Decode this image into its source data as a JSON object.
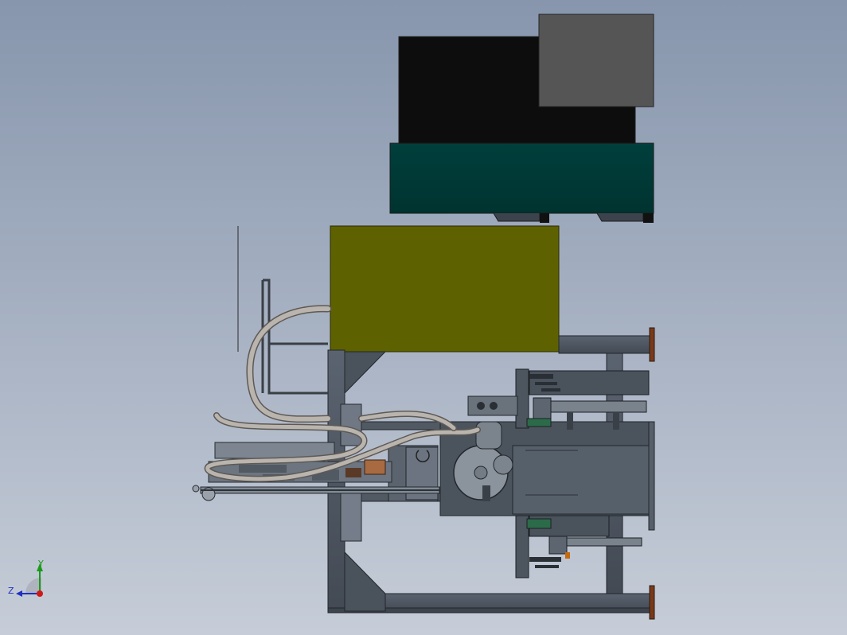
{
  "colors": {
    "background_top": "#8796ad",
    "background_bottom": "#c6cdd8",
    "black_cabinet": "#0d0d0d",
    "gray_cabinet": "#555555",
    "teal_cabinet": "#003a37",
    "olive_hopper": "#5e6100",
    "frame_steel": "#4f5762",
    "hose": "#b9b3ae"
  },
  "triad": {
    "y_label": "Y",
    "z_label": "Z",
    "icon": "coordinate-triad-icon"
  }
}
